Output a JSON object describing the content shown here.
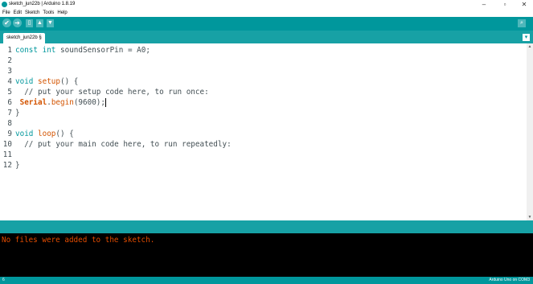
{
  "window": {
    "title": "sketch_jun22b | Arduino 1.8.19"
  },
  "menu": [
    "File",
    "Edit",
    "Sketch",
    "Tools",
    "Help"
  ],
  "toolbar": {
    "verify_icon": "✔",
    "upload_icon": "➔",
    "new_icon": "▯",
    "open_icon": "▲",
    "save_icon": "▼",
    "serial_icon": "⌕"
  },
  "tab": {
    "label": "sketch_jun22b §",
    "menu_icon": "▾"
  },
  "editor": {
    "lines": [
      {
        "num": "1",
        "text": "const int soundSensorPin = A0;"
      },
      {
        "num": "2",
        "text": ""
      },
      {
        "num": "3",
        "text": ""
      },
      {
        "num": "4",
        "text": "void setup() {"
      },
      {
        "num": "5",
        "text": "  // put your setup code here, to run once:"
      },
      {
        "num": "6",
        "text": " Serial.begin(9600);"
      },
      {
        "num": "7",
        "text": "}"
      },
      {
        "num": "8",
        "text": ""
      },
      {
        "num": "9",
        "text": "void loop() {"
      },
      {
        "num": "10",
        "text": "  // put your main code here, to run repeatedly:"
      },
      {
        "num": "11",
        "text": ""
      },
      {
        "num": "12",
        "text": "}"
      }
    ]
  },
  "console": {
    "message": "No files were added to the sketch."
  },
  "status": {
    "line": "6",
    "board": "Arduino Uno on COM3"
  }
}
